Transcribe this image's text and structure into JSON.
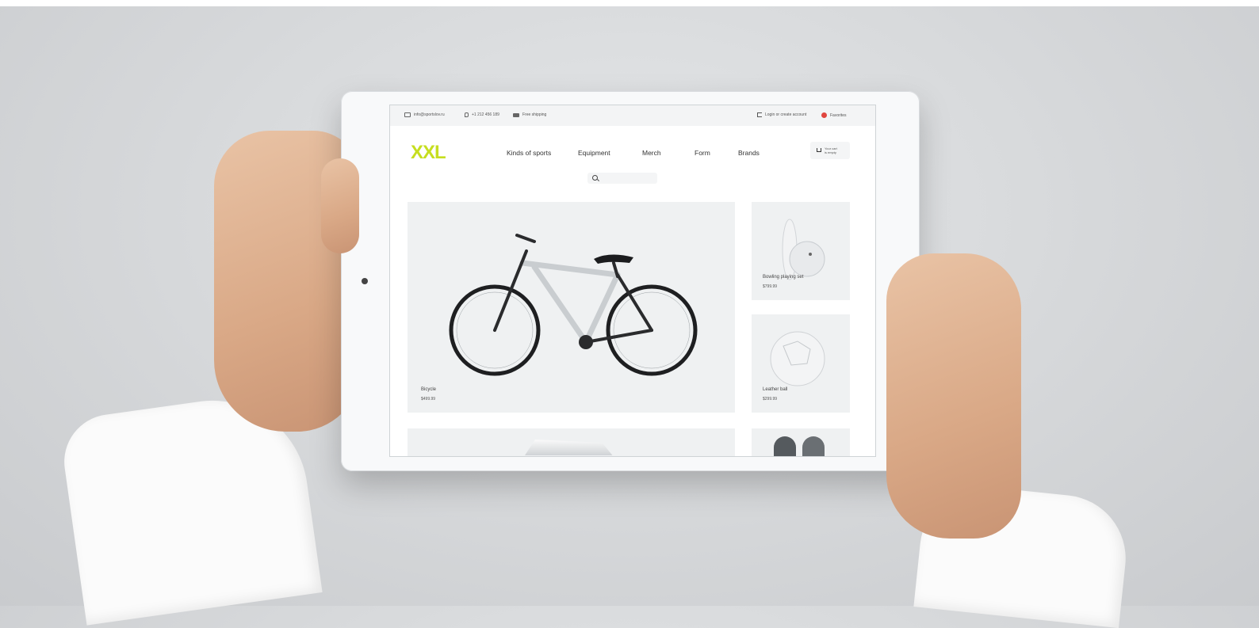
{
  "topbar": {
    "email": "info@sportslov.ru",
    "phone": "+1 212 456 189",
    "shipping": "Free shipping",
    "login": "Login or create account",
    "favorites": "Favorites"
  },
  "header": {
    "logo": "XXL",
    "nav": [
      "Kinds of sports",
      "Equipment",
      "Merch",
      "Form",
      "Brands"
    ],
    "cart_line1": "Your cart",
    "cart_line2": "is empty"
  },
  "products": {
    "hero": {
      "title": "Bicycle",
      "price": "$499.99"
    },
    "side1": {
      "title": "Bowling playing set",
      "price": "$799.99"
    },
    "side2": {
      "title": "Leather ball",
      "price": "$299.99"
    }
  },
  "colors": {
    "logo": "#c6de1f",
    "favorite": "#e0463f"
  }
}
